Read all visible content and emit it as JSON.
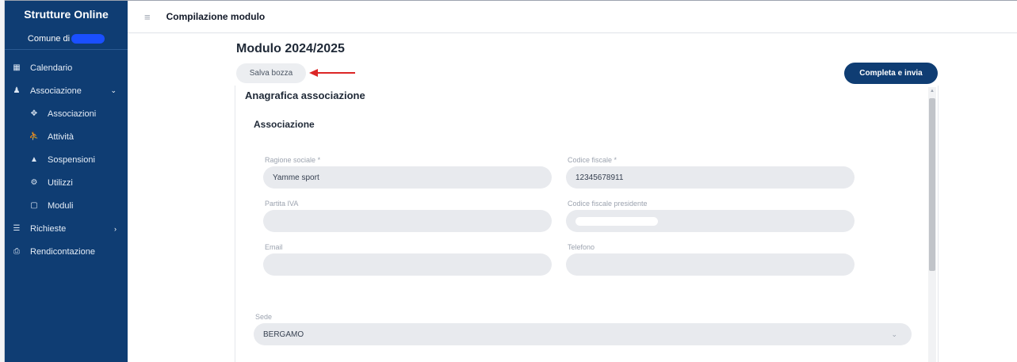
{
  "sidebar": {
    "brand": "Strutture Online",
    "comune_label": "Comune di",
    "items": [
      {
        "label": "Calendario",
        "icon": "calendar-icon"
      },
      {
        "label": "Associazione",
        "icon": "group-icon",
        "expanded": true
      },
      {
        "label": "Associazioni",
        "icon": "handshake-icon",
        "sub": true
      },
      {
        "label": "Attività",
        "icon": "run-icon",
        "sub": true
      },
      {
        "label": "Sospensioni",
        "icon": "warning-icon",
        "sub": true
      },
      {
        "label": "Utilizzi",
        "icon": "gear-icon",
        "sub": true
      },
      {
        "label": "Moduli",
        "icon": "file-icon",
        "sub": true
      },
      {
        "label": "Richieste",
        "icon": "list-icon",
        "expanded": false
      },
      {
        "label": "Rendicontazione",
        "icon": "print-icon"
      }
    ]
  },
  "topbar": {
    "title": "Compilazione modulo"
  },
  "main": {
    "page_title": "Modulo 2024/2025",
    "draft_button": "Salva bozza",
    "submit_button": "Completa e invia",
    "section_title": "Anagrafica associazione",
    "subsection_title": "Associazione",
    "fields": {
      "ragione_sociale": {
        "label": "Ragione sociale",
        "required_mark": "*",
        "value": "Yamme sport"
      },
      "codice_fiscale": {
        "label": "Codice fiscale",
        "required_mark": "*",
        "value": "12345678911"
      },
      "partita_iva": {
        "label": "Partita IVA",
        "value": ""
      },
      "codice_fiscale_presidente": {
        "label": "Codice fiscale presidente",
        "value": ""
      },
      "email": {
        "label": "Email",
        "value": ""
      },
      "telefono": {
        "label": "Telefono",
        "value": ""
      },
      "sede": {
        "label": "Sede",
        "value": "BERGAMO"
      }
    }
  },
  "colors": {
    "sidebar_bg": "#0f3d73",
    "primary_button": "#0f3d73",
    "field_bg": "#e8eaee",
    "annotation_arrow": "#dc2626"
  }
}
